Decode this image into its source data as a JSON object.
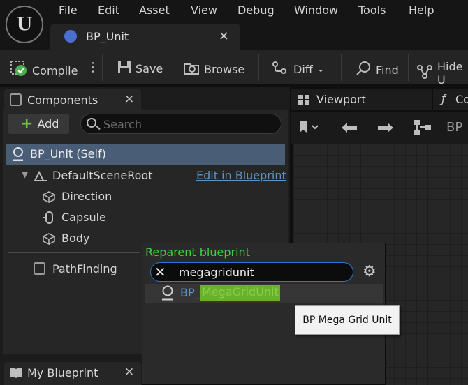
{
  "menu": [
    "File",
    "Edit",
    "Asset",
    "View",
    "Debug",
    "Window",
    "Tools",
    "Help"
  ],
  "document_tab": {
    "label": "BP_Unit"
  },
  "toolbar": {
    "compile": "Compile",
    "save": "Save",
    "browse": "Browse",
    "diff": "Diff",
    "find": "Find",
    "hide": "Hide U"
  },
  "components_panel": {
    "title": "Components",
    "add_label": "Add",
    "search_placeholder": "Search",
    "tree": {
      "self": "BP_Unit (Self)",
      "root": "DefaultSceneRoot",
      "edit_link": "Edit in Blueprint",
      "children": [
        "Direction",
        "Capsule",
        "Body"
      ],
      "path_finding": "PathFinding"
    }
  },
  "my_blueprint": {
    "title": "My Blueprint"
  },
  "viewport": {
    "tab": "Viewport",
    "second_tab": "Co",
    "breadcrumb": "BP"
  },
  "reparent_popup": {
    "title": "Reparent blueprint",
    "search_value": "megagridunit",
    "result_prefix": "BP_",
    "result_highlight": "MegaGridUnit",
    "tooltip": "BP Mega Grid Unit"
  },
  "colors": {
    "accent_green": "#3fd13f",
    "selection_blue": "#4a5d77",
    "link_blue": "#5e93c6",
    "focus_blue": "#2c77d6",
    "highlight_green": "#68b22b"
  }
}
